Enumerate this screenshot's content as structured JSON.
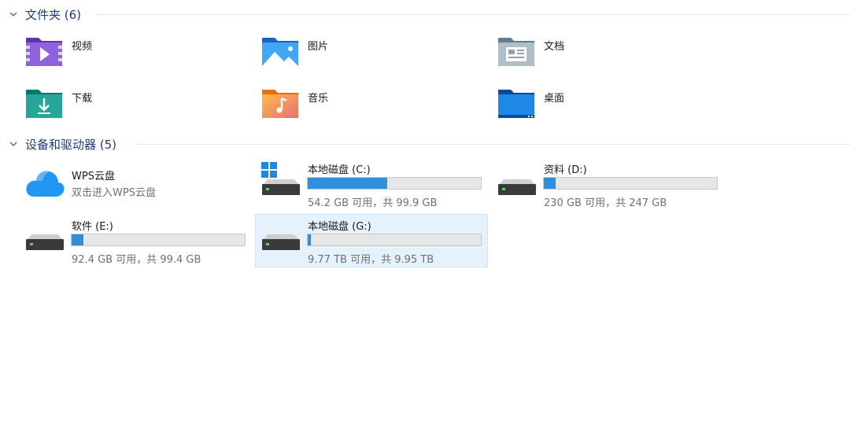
{
  "sections": {
    "folders": {
      "title": "文件夹 (6)"
    },
    "drives": {
      "title": "设备和驱动器 (5)"
    }
  },
  "folders": [
    {
      "label": "视频",
      "icon": "videos-folder-icon",
      "color": "#7b4fc9"
    },
    {
      "label": "图片",
      "icon": "pictures-folder-icon",
      "color": "#1e88d8"
    },
    {
      "label": "文档",
      "icon": "documents-folder-icon",
      "color": "#8a9bb0"
    },
    {
      "label": "下载",
      "icon": "downloads-folder-icon",
      "color": "#159a8c"
    },
    {
      "label": "音乐",
      "icon": "music-folder-icon",
      "color": "#f08a5d"
    },
    {
      "label": "桌面",
      "icon": "desktop-folder-icon",
      "color": "#1a8ad8"
    }
  ],
  "cloud": {
    "name": "WPS云盘",
    "subtitle": "双击进入WPS云盘",
    "icon": "cloud-icon"
  },
  "drives": [
    {
      "name": "本地磁盘 (C:)",
      "free": "54.2 GB 可用，共 99.9 GB",
      "used_fraction": 0.457,
      "windows_logo": true
    },
    {
      "name": "资料 (D:)",
      "free": "230 GB 可用，共 247 GB",
      "used_fraction": 0.069,
      "windows_logo": false
    },
    {
      "name": "软件 (E:)",
      "free": "92.4 GB 可用，共 99.4 GB",
      "used_fraction": 0.07,
      "windows_logo": false
    },
    {
      "name": "本地磁盘 (G:)",
      "free": "9.77 TB 可用，共 9.95 TB",
      "used_fraction": 0.018,
      "windows_logo": false,
      "selected": true
    }
  ],
  "colors": {
    "accent_blue": "#2f8fdc",
    "header_text": "#1f3c7a",
    "selection_bg": "#e5f1fb"
  }
}
